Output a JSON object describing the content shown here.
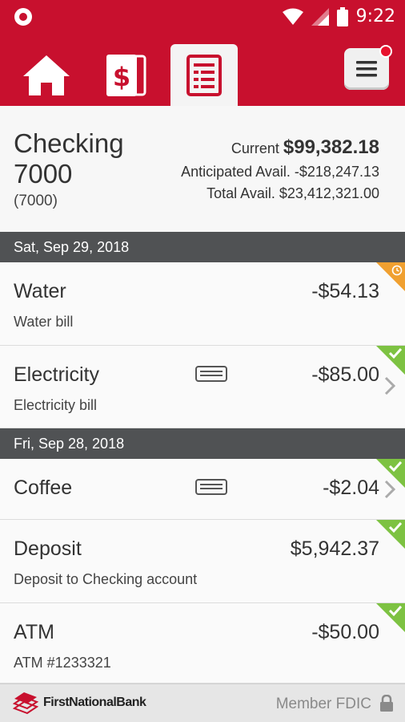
{
  "status_bar": {
    "time": "9:22",
    "icons": [
      "notification-icon",
      "wifi-icon",
      "signal-icon",
      "battery-icon"
    ]
  },
  "nav": {
    "tabs": [
      {
        "name": "home",
        "icon": "home-icon",
        "active": false
      },
      {
        "name": "transfers",
        "icon": "dollar-card-icon",
        "active": false
      },
      {
        "name": "accounts",
        "icon": "register-icon",
        "active": true
      }
    ],
    "menu_icon": "menu-icon",
    "menu_has_notification": true
  },
  "account": {
    "name": "Checking 7000",
    "number": "(7000)",
    "current_label": "Current",
    "current_value": "$99,382.18",
    "anticipated_label": "Anticipated Avail.",
    "anticipated_value": "-$218,247.13",
    "total_label": "Total Avail.",
    "total_value": "$23,412,321.00"
  },
  "groups": [
    {
      "date": "Sat, Sep 29, 2018",
      "transactions": [
        {
          "title": "Water",
          "description": "Water bill",
          "amount": "-$54.13",
          "status": "pending",
          "has_memo": false,
          "has_detail": false
        },
        {
          "title": "Electricity",
          "description": "Electricity bill",
          "amount": "-$85.00",
          "status": "cleared",
          "has_memo": true,
          "has_detail": true
        }
      ]
    },
    {
      "date": "Fri, Sep 28, 2018",
      "transactions": [
        {
          "title": "Coffee",
          "description": "",
          "amount": "-$2.04",
          "status": "cleared",
          "has_memo": true,
          "has_detail": true
        },
        {
          "title": "Deposit",
          "description": "Deposit to Checking account",
          "amount": "$5,942.37",
          "status": "cleared",
          "has_memo": false,
          "has_detail": false
        },
        {
          "title": "ATM",
          "description": "ATM #1233321",
          "amount": "-$50.00",
          "status": "cleared",
          "has_memo": false,
          "has_detail": false
        }
      ]
    }
  ],
  "footer": {
    "bank_name": "FirstNationalBank",
    "member_text": "Member FDIC"
  },
  "colors": {
    "brand_red": "#c8102e",
    "cleared_green": "#7dc242",
    "pending_orange": "#f0a030",
    "date_header": "#505254"
  }
}
